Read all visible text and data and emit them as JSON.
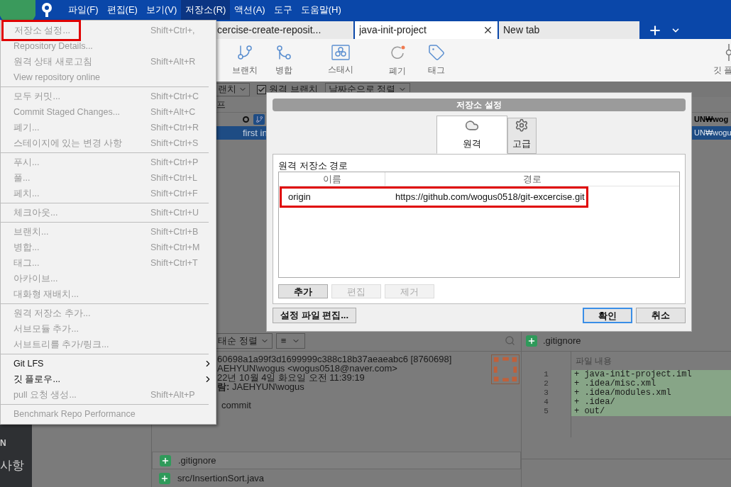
{
  "menu_bar": {
    "items": [
      {
        "label": "파일(F)",
        "selected": false
      },
      {
        "label": "편집(E)",
        "selected": false
      },
      {
        "label": "보기(V)",
        "selected": false
      },
      {
        "label": "저장소(R)",
        "selected": true
      },
      {
        "label": "액션(A)",
        "selected": false
      },
      {
        "label": "도구",
        "selected": false
      },
      {
        "label": "도움말(H)",
        "selected": false
      }
    ]
  },
  "tabs": [
    {
      "label": "cercise-create-reposit...",
      "selected": false,
      "closable": false
    },
    {
      "label": "java-init-project",
      "selected": true,
      "closable": true
    },
    {
      "label": "New tab",
      "selected": false,
      "closable": false
    }
  ],
  "toolbar": {
    "buttons": [
      {
        "label": "브랜치"
      },
      {
        "label": "병합"
      },
      {
        "label": "스태시"
      },
      {
        "label": "폐기"
      },
      {
        "label": "태그"
      },
      {
        "label": "깃 플"
      }
    ]
  },
  "filter_bar": {
    "branch_dropdown": "랜치",
    "remote_branches": {
      "label": "원격 브랜치",
      "checked": true
    },
    "sort_dropdown": "날짜순으로 정렬"
  },
  "graph": {
    "column_1": "프",
    "rows": [
      {
        "description": "",
        "author": "UN₩wog",
        "selected": false,
        "has_branch_tag": true
      },
      {
        "description": "first in",
        "author": "UN₩wogu",
        "selected": true,
        "has_branch_tag": false
      }
    ]
  },
  "sidebar": {
    "items": [
      "N",
      "사항"
    ]
  },
  "repository_menu": {
    "items": [
      {
        "kind": "item",
        "label": "저장소 설정...",
        "shortcut": "Shift+Ctrl+,",
        "disabled": true,
        "highlighted": true
      },
      {
        "kind": "item",
        "label": "Repository Details...",
        "disabled": true,
        "highlighted": false
      },
      {
        "kind": "item",
        "label": "원격 상태 새로고침",
        "shortcut": "Shift+Alt+R",
        "disabled": true,
        "highlighted": false
      },
      {
        "kind": "item",
        "label": "View repository online",
        "disabled": true,
        "highlighted": false
      },
      {
        "kind": "separator"
      },
      {
        "kind": "item",
        "label": "모두 커밋...",
        "shortcut": "Shift+Ctrl+C",
        "disabled": true,
        "highlighted": false
      },
      {
        "kind": "item",
        "label": "Commit Staged Changes...",
        "shortcut": "Shift+Alt+C",
        "disabled": true,
        "highlighted": false
      },
      {
        "kind": "item",
        "label": "폐기...",
        "shortcut": "Shift+Ctrl+R",
        "disabled": true,
        "highlighted": false
      },
      {
        "kind": "item",
        "label": "스테이지에 있는 변경 사항",
        "shortcut": "Shift+Ctrl+S",
        "disabled": true,
        "highlighted": false
      },
      {
        "kind": "separator"
      },
      {
        "kind": "item",
        "label": "푸시...",
        "shortcut": "Shift+Ctrl+P",
        "disabled": true,
        "highlighted": false
      },
      {
        "kind": "item",
        "label": "풀...",
        "shortcut": "Shift+Ctrl+L",
        "disabled": true,
        "highlighted": false
      },
      {
        "kind": "item",
        "label": "페치...",
        "shortcut": "Shift+Ctrl+F",
        "disabled": true,
        "highlighted": false
      },
      {
        "kind": "separator"
      },
      {
        "kind": "item",
        "label": "체크아웃...",
        "shortcut": "Shift+Ctrl+U",
        "disabled": true,
        "highlighted": false
      },
      {
        "kind": "separator"
      },
      {
        "kind": "item",
        "label": "브랜치...",
        "shortcut": "Shift+Ctrl+B",
        "disabled": true,
        "highlighted": false
      },
      {
        "kind": "item",
        "label": "병합...",
        "shortcut": "Shift+Ctrl+M",
        "disabled": true,
        "highlighted": false
      },
      {
        "kind": "item",
        "label": "태그...",
        "shortcut": "Shift+Ctrl+T",
        "disabled": true,
        "highlighted": false
      },
      {
        "kind": "item",
        "label": "아카이브...",
        "disabled": true,
        "highlighted": false
      },
      {
        "kind": "item",
        "label": "대화형 재배치...",
        "disabled": true,
        "highlighted": false
      },
      {
        "kind": "separator"
      },
      {
        "kind": "item",
        "label": "원격 저장소 추가...",
        "disabled": true,
        "highlighted": false
      },
      {
        "kind": "item",
        "label": "서브모듈 추가...",
        "disabled": true,
        "highlighted": false
      },
      {
        "kind": "item",
        "label": "서브트리를 추가/링크...",
        "disabled": true,
        "highlighted": false
      },
      {
        "kind": "separator"
      },
      {
        "kind": "item",
        "label": "Git LFS",
        "disabled": false,
        "highlighted": false,
        "submenu": true
      },
      {
        "kind": "item",
        "label": "깃 플로우...",
        "disabled": false,
        "highlighted": false,
        "submenu": true
      },
      {
        "kind": "item",
        "label": "pull 요청 생성...",
        "shortcut": "Shift+Alt+P",
        "disabled": true,
        "highlighted": false
      },
      {
        "kind": "separator"
      },
      {
        "kind": "item",
        "label": "Benchmark Repo Performance",
        "disabled": true,
        "highlighted": false
      }
    ]
  },
  "dialog": {
    "title": "저장소 설정",
    "tabs": [
      {
        "label": "원격",
        "selected": true
      },
      {
        "label": "고급",
        "selected": false
      }
    ],
    "section_title": "원격 저장소 경로",
    "table": {
      "columns": [
        "이름",
        "경로"
      ],
      "rows": [
        {
          "name": "origin",
          "path": "https://github.com/wogus0518/git-excercise.git",
          "highlighted": true
        }
      ]
    },
    "row_buttons": [
      {
        "label": "추가",
        "disabled": false
      },
      {
        "label": "편집",
        "disabled": true
      },
      {
        "label": "제거",
        "disabled": true
      }
    ],
    "edit_config_button": "설정 파일 편집...",
    "buttons": [
      {
        "label": "확인",
        "default": true
      },
      {
        "label": "취소",
        "default": false
      }
    ]
  },
  "details": {
    "sort_dropdown": "태순 정렬",
    "view_dropdown": "≡",
    "lines": [
      "60698a1a99f3d1699999c388c18b37aeaeabc6 [8760698]",
      "AEHYUN\\wogus <wogus0518@naver.com>",
      "22년 10월 4일 화요일 오전 11:39:19",
      "**람:** JAEHYUN\\wogus"
    ],
    "message": "commit",
    "files": [
      {
        "name": ".gitignore",
        "selected": true
      },
      {
        "name": "src/InsertionSort.java",
        "selected": false
      }
    ]
  },
  "diff": {
    "file": ".gitignore",
    "column_header": "파일 내용",
    "lines": [
      {
        "number": "1",
        "text": "+ java-init-project.iml",
        "kind": "added"
      },
      {
        "number": "2",
        "text": "+ .idea/misc.xml",
        "kind": "added"
      },
      {
        "number": "3",
        "text": "+ .idea/modules.xml",
        "kind": "added"
      },
      {
        "number": "4",
        "text": "+ .idea/",
        "kind": "added"
      },
      {
        "number": "5",
        "text": "+ out/",
        "kind": "added"
      }
    ]
  }
}
